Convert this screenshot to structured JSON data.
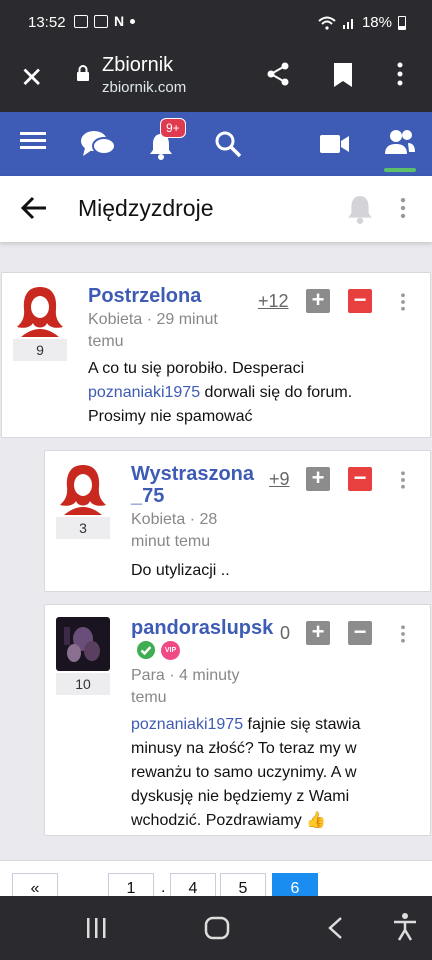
{
  "status": {
    "time": "13:52",
    "battery": "18%"
  },
  "browser": {
    "title": "Zbiornik",
    "url": "zbiornik.com"
  },
  "nav": {
    "notif_badge": "9+"
  },
  "page": {
    "title": "Międzyzdroje"
  },
  "posts": [
    {
      "name": "Postrzelona",
      "meta": "Kobieta · 29 minut temu",
      "reputation": "9",
      "score": "+12",
      "body_parts": [
        "A co tu się porobiło. Desperaci ",
        "poznaniaki1975",
        " dorwali się do forum. Prosimy nie spamować"
      ]
    },
    {
      "name_line1": "Wystraszona",
      "name_line2": "_75",
      "meta_line1": "Kobieta · 28",
      "meta_line2": "minut temu",
      "reputation": "3",
      "score": "+9",
      "body": "Do utylizacji .."
    },
    {
      "name": "pandoraslupsk",
      "vip": "VIP",
      "meta_line1": "Para · 4 minuty",
      "meta_line2": "temu",
      "reputation": "10",
      "score": "0",
      "mention": "poznaniaki1975",
      "body_rest": " fajnie się stawia minusy na złość? To teraz my w rewanżu to samo uczynimy. A w dyskusję nie będziemy z Wami wchodzić. Pozdrawiamy 👍"
    }
  ],
  "pagination": {
    "prev": "«",
    "pages": [
      "1",
      "4",
      "5",
      "6"
    ],
    "ellipsis": ".",
    "current": "6"
  },
  "colors": {
    "brand": "#3e5bb5",
    "vote_down": "#e8403e",
    "active_page": "#1a8ef0"
  }
}
